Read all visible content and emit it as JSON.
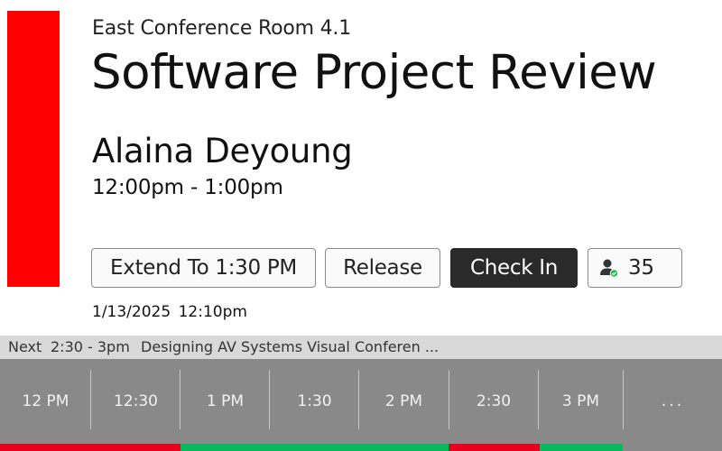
{
  "room": {
    "name": "East Conference Room 4.1",
    "status_color": "#ff0000"
  },
  "meeting": {
    "title": "Software Project Review",
    "organizer": "Alaina Deyoung",
    "time_range": "12:00pm - 1:00pm"
  },
  "actions": {
    "extend_label": "Extend To 1:30 PM",
    "release_label": "Release",
    "checkin_label": "Check In",
    "occupancy_icon": "person-checked-icon",
    "occupancy_count": "35"
  },
  "current_datetime": {
    "date": "1/13/2025",
    "time": "12:10pm"
  },
  "next_meeting": {
    "label": "Next",
    "time": "2:30 - 3pm",
    "title": "Designing AV Systems Visual Conferen ..."
  },
  "timeline": {
    "slots": [
      "12 PM",
      "12:30",
      "1 PM",
      "1:30",
      "2 PM",
      "2:30",
      "3 PM",
      "..."
    ],
    "availability": [
      {
        "from": "12 PM",
        "to": "1 PM",
        "state": "busy"
      },
      {
        "from": "1 PM",
        "to": "2:30",
        "state": "free"
      },
      {
        "from": "2:30",
        "to": "3 PM",
        "state": "busy"
      },
      {
        "from": "3 PM",
        "to": "3:30",
        "state": "free"
      }
    ],
    "colors": {
      "busy": "#e8001f",
      "free": "#08b85a"
    }
  }
}
